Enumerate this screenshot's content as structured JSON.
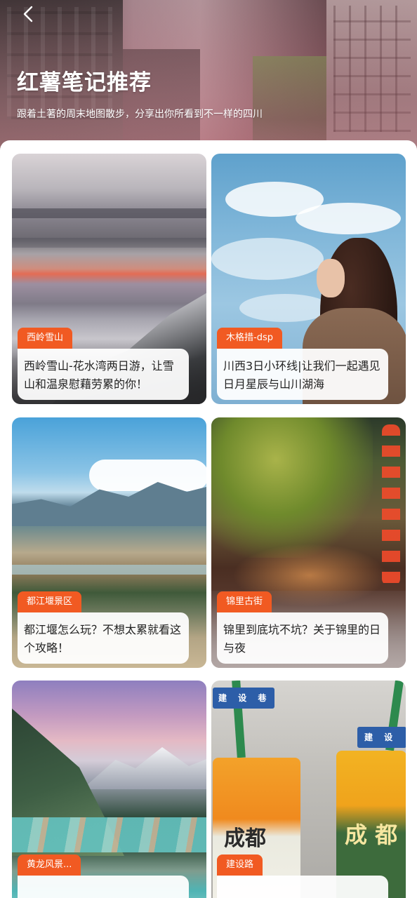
{
  "header": {
    "back_icon": "chevron-left-icon",
    "title": "红薯笔记推荐",
    "subtitle": "跟着土著的周末地图散步，分享出你所看到不一样的四川"
  },
  "colors": {
    "tag_background": "#f15a22",
    "tag_text": "#ffffff",
    "caption_text": "#222222"
  },
  "cards": [
    {
      "tag": "西岭雪山",
      "caption": "西岭雪山-花水湾两日游，让雪山和温泉慰藉劳累的你！"
    },
    {
      "tag": "木格措-dsp",
      "caption": "川西3日小环线|让我们一起遇见日月星辰与山川湖海"
    },
    {
      "tag": "都江堰景区",
      "caption": "都江堰怎么玩？不想太累就看这个攻略！"
    },
    {
      "tag": "锦里古街",
      "caption": "锦里到底坑不坑？关于锦里的日与夜"
    },
    {
      "tag": "黄龙风景...",
      "caption": ""
    },
    {
      "tag": "建设路",
      "caption": ""
    }
  ],
  "photo_text": {
    "sign_1": "建 设 巷",
    "sign_2": "建 设",
    "cup_brand_1": "成都",
    "cup_brand_2": "成 都"
  }
}
